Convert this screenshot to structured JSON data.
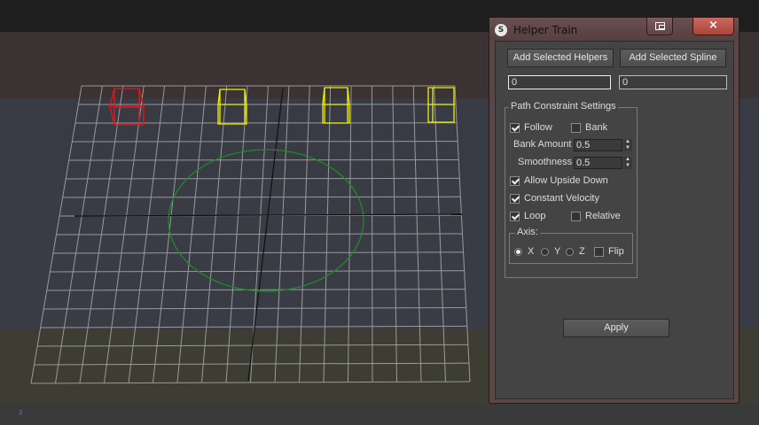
{
  "viewport": {
    "axis_label": "z",
    "colors": {
      "band_top": "#1e1e1e",
      "band_upper": "#3b3333",
      "band_middle": "#383a44",
      "band_lower": "#3a3c45",
      "band_floor": "#3d3d34",
      "band_bottom": "#3a3a3a",
      "grid": "#b9b9b9",
      "axis_line": "#111111",
      "circle": "#1f8a2a",
      "helper_selected": "#e01818",
      "helper": "#f0f000"
    },
    "helpers": [
      "helper-red",
      "helper-yellow-1",
      "helper-yellow-2",
      "helper-yellow-3"
    ]
  },
  "dialog": {
    "title": "Helper Train",
    "app_icon": "S",
    "close_symbol": "×",
    "buttons": {
      "add_helpers": "Add Selected Helpers",
      "add_spline": "Add Selected Spline",
      "apply": "Apply"
    },
    "fields": {
      "helpers_count": "0",
      "spline_count": "0"
    },
    "path_constraint": {
      "title": "Path Constraint Settings",
      "follow": {
        "label": "Follow",
        "checked": true
      },
      "bank": {
        "label": "Bank",
        "checked": false
      },
      "bank_amount": {
        "label": "Bank Amount",
        "value": "0.5"
      },
      "smoothness": {
        "label": "Smoothness",
        "value": "0.5"
      },
      "allow_upside_down": {
        "label": "Allow Upside Down",
        "checked": true
      },
      "constant_velocity": {
        "label": "Constant Velocity",
        "checked": true
      },
      "loop": {
        "label": "Loop",
        "checked": true
      },
      "relative": {
        "label": "Relative",
        "checked": false
      },
      "axis": {
        "title": "Axis:",
        "options": [
          "X",
          "Y",
          "Z"
        ],
        "selected": "X",
        "flip": {
          "label": "Flip",
          "checked": false
        }
      }
    }
  }
}
